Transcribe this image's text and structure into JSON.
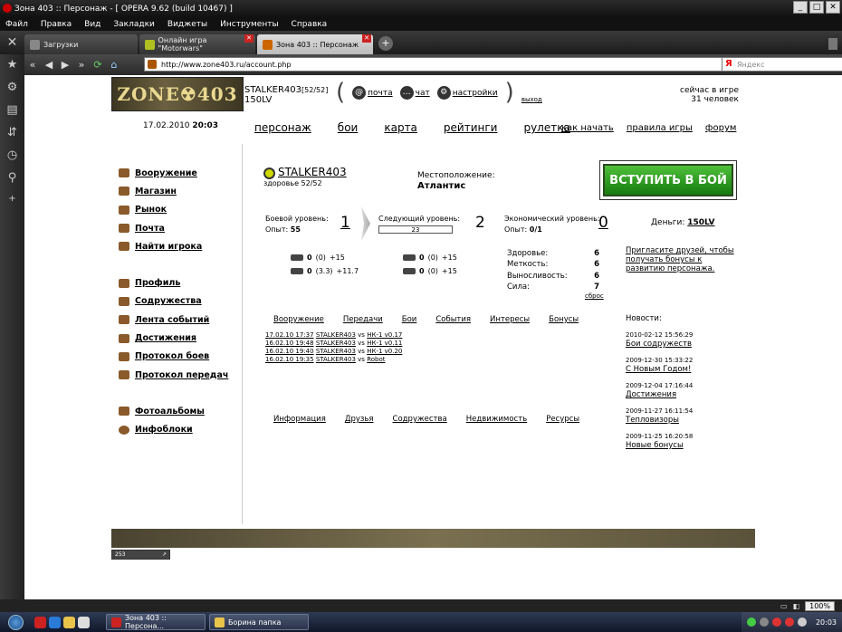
{
  "window": {
    "title": "Зона 403 :: Персонаж - [ OPERA 9.62 (build 10467) ]",
    "buttons": [
      "_",
      "□",
      "✕"
    ]
  },
  "menubar": [
    "Файл",
    "Правка",
    "Вид",
    "Закладки",
    "Виджеты",
    "Инструменты",
    "Справка"
  ],
  "tabs": [
    {
      "label": "Загрузки",
      "color": "#888888"
    },
    {
      "label": "Онлайн игра \"Motorwars\"",
      "color": "#b0c020"
    },
    {
      "label": "Зона 403 :: Персонаж",
      "color": "#cc6600"
    }
  ],
  "address": {
    "url": "http://www.zone403.ru/account.php",
    "search_placeholder": "Яндекс",
    "search_logo": "Я"
  },
  "header": {
    "logo": "ZONE☢403",
    "user_name": "STALKER403",
    "user_hp": "[52/52]",
    "user_level": "150LV",
    "links": {
      "mail": "почта",
      "chat": "чат",
      "settings": "настройки",
      "exit": "выход"
    },
    "online_label": "сейчас в игре",
    "online_count": "31 человек"
  },
  "date": "17.02.2010",
  "time": "20:03",
  "mainnav": [
    "персонаж",
    "бои",
    "карта",
    "рейтинги",
    "рулетка"
  ],
  "subnav": [
    "как начать",
    "правила игры",
    "форум"
  ],
  "menu": {
    "group1": [
      "Вооружение",
      "Магазин",
      "Рынок",
      "Почта",
      "Найти игрока"
    ],
    "group2": [
      "Профиль",
      "Содружества",
      "Лента событий",
      "Достижения",
      "Протокол боев",
      "Протокол передач"
    ],
    "group3": [
      "Фотоальбомы",
      "Инфоблоки"
    ]
  },
  "character": {
    "name": "STALKER403",
    "health": "здоровье 52/52",
    "location_label": "Местоположение:",
    "location": "Атлантис",
    "fight_button": "ВСТУПИТЬ В БОЙ"
  },
  "levels": {
    "combat_label": "Боевой уровень:",
    "exp_label": "Опыт:",
    "exp_value": "55",
    "combat_value": "1",
    "next_label": "Следующий уровень:",
    "next_exp": "23",
    "next_value": "2",
    "econ_label": "Экономический уровень:",
    "econ_exp_label": "Опыт:",
    "econ_exp_value": "0/1",
    "econ_value": "0",
    "money_label": "Деньги:",
    "money_value": "150LV"
  },
  "weapons": {
    "w1": {
      "val": "0",
      "sub": "(0)",
      "plus": "+15"
    },
    "w2": {
      "val": "0",
      "sub": "(3.3)",
      "plus": "+11.7"
    },
    "w3": {
      "val": "0",
      "sub": "(0)",
      "plus": "+15"
    },
    "w4": {
      "val": "0",
      "sub": "(0)",
      "plus": "+15"
    }
  },
  "stats": [
    {
      "label": "Здоровье:",
      "value": "6"
    },
    {
      "label": "Меткость:",
      "value": "6"
    },
    {
      "label": "Выносливость:",
      "value": "6"
    },
    {
      "label": "Сила:",
      "value": "7"
    }
  ],
  "reset": "сброс",
  "invite": {
    "text": "Пригласите друзей, чтобы получать бонусы к развитию персонажа."
  },
  "tabs1": [
    "Вооружение",
    "Передачи",
    "Бои",
    "События",
    "Интересы",
    "Бонусы"
  ],
  "battle_log": [
    {
      "date": "17.02.10 17:37",
      "p1": "STALKER403",
      "vs": "vs",
      "p2": "НК-1 v0.17"
    },
    {
      "date": "16.02.10 19:48",
      "p1": "STALKER403",
      "vs": "vs",
      "p2": "НК-1 v0.11"
    },
    {
      "date": "16.02.10 19:40",
      "p1": "STALKER403",
      "vs": "vs",
      "p2": "НК-1 v0.20"
    },
    {
      "date": "16.02.10 19:35",
      "p1": "STALKER403",
      "vs": "vs",
      "p2": "Robot"
    }
  ],
  "tabs2": [
    "Информация",
    "Друзья",
    "Содружества",
    "Недвижимость",
    "Ресурсы"
  ],
  "news": {
    "title": "Новости:",
    "items": [
      {
        "date": "2010-02-12 15:56:29",
        "title": "Бои содружеств"
      },
      {
        "date": "2009-12-30 15:33:22",
        "title": "С Новым Годом!"
      },
      {
        "date": "2009-12-04 17:16:44",
        "title": "Достижения"
      },
      {
        "date": "2009-11-27 16:11:54",
        "title": "Тепловизоры"
      },
      {
        "date": "2009-11-25 16:20:58",
        "title": "Новые бонусы"
      }
    ]
  },
  "counter": "253",
  "statusbar": {
    "zoom": "100%"
  },
  "taskbar": {
    "buttons": [
      "Зона 403 :: Персона...",
      "Борина папка"
    ],
    "clock": "20:03"
  }
}
